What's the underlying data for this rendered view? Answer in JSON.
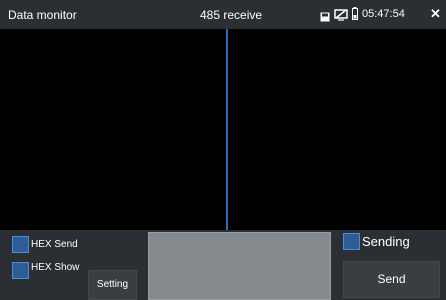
{
  "status_bar": {
    "app_title": "Data monitor",
    "mode_title": "485 receive",
    "time": "05:47:54",
    "close_glyph": "✕",
    "icons": [
      "save-icon",
      "screen-off-icon",
      "battery-icon",
      "close-icon"
    ]
  },
  "controls": {
    "hex_send_label": "HEX Send",
    "hex_show_label": "HEX Show",
    "setting_label": "Setting",
    "sending_label": "Sending",
    "send_label": "Send"
  },
  "colors": {
    "accent": "#2a6fb4",
    "checkbox_fill": "#2c5d96",
    "panel_bg": "#2b2e33"
  }
}
